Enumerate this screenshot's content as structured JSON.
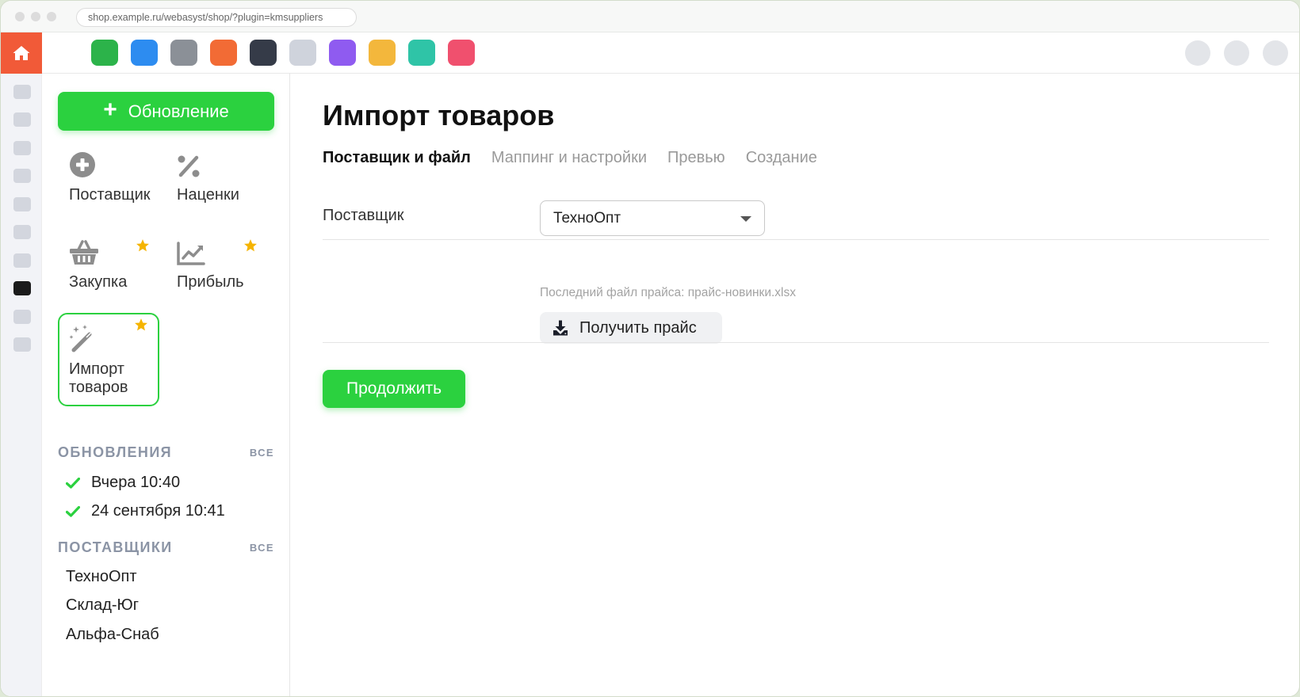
{
  "browser": {
    "url": "shop.example.ru/webasyst/shop/?plugin=kmsuppliers"
  },
  "appbar": {
    "apps": [
      {
        "icon": "app-green-icon",
        "color": "#2cb34a"
      },
      {
        "icon": "app-blue-icon",
        "color": "#2d8cf0"
      },
      {
        "icon": "app-gray-icon",
        "color": "#8b9097"
      },
      {
        "icon": "app-orange-icon",
        "color": "#f26b35"
      },
      {
        "icon": "app-dark-icon",
        "color": "#353b48"
      },
      {
        "icon": "app-light-icon",
        "color": "#cfd3dc"
      },
      {
        "icon": "app-purple-icon",
        "color": "#8f5bf0"
      },
      {
        "icon": "app-yellow-icon",
        "color": "#f3b73c"
      },
      {
        "icon": "app-teal-icon",
        "color": "#2fc4a7"
      },
      {
        "icon": "app-pink-icon",
        "color": "#f0506e"
      }
    ]
  },
  "sidebar": {
    "new_button": "Обновление",
    "tiles": [
      {
        "label": "Поставщик",
        "icon": "plus-circle-icon",
        "starred": false
      },
      {
        "label": "Наценки",
        "icon": "percent-icon",
        "starred": false
      },
      {
        "label": "Закупка",
        "icon": "basket-icon",
        "starred": true
      },
      {
        "label": "Прибыль",
        "icon": "chart-line-icon",
        "starred": true
      },
      {
        "label": "Импорт товаров",
        "icon": "magic-wand-icon",
        "starred": true,
        "selected": true
      }
    ],
    "updates": {
      "title": "ОБНОВЛЕНИЯ",
      "all": "ВСЕ",
      "items": [
        "Вчера 10:40",
        "24 сентября 10:41"
      ]
    },
    "suppliers": {
      "title": "ПОСТАВЩИКИ",
      "all": "ВСЕ",
      "items": [
        "ТехноОпт",
        "Склад-Юг",
        "Альфа-Снаб"
      ]
    }
  },
  "main": {
    "title": "Импорт товаров",
    "tabs": [
      "Поставщик и файл",
      "Маппинг и настройки",
      "Превью",
      "Создание"
    ],
    "active_tab": "Поставщик и файл",
    "supplier_label": "Поставщик",
    "supplier_value": "ТехноОпт",
    "last_file_hint": "Последний файл прайса: прайс-новинки.xlsx",
    "get_price_button": "Получить прайс",
    "continue_button": "Продолжить"
  },
  "colors": {
    "accent": "#2bd13f",
    "home": "#f15a38",
    "star": "#f5b400"
  }
}
